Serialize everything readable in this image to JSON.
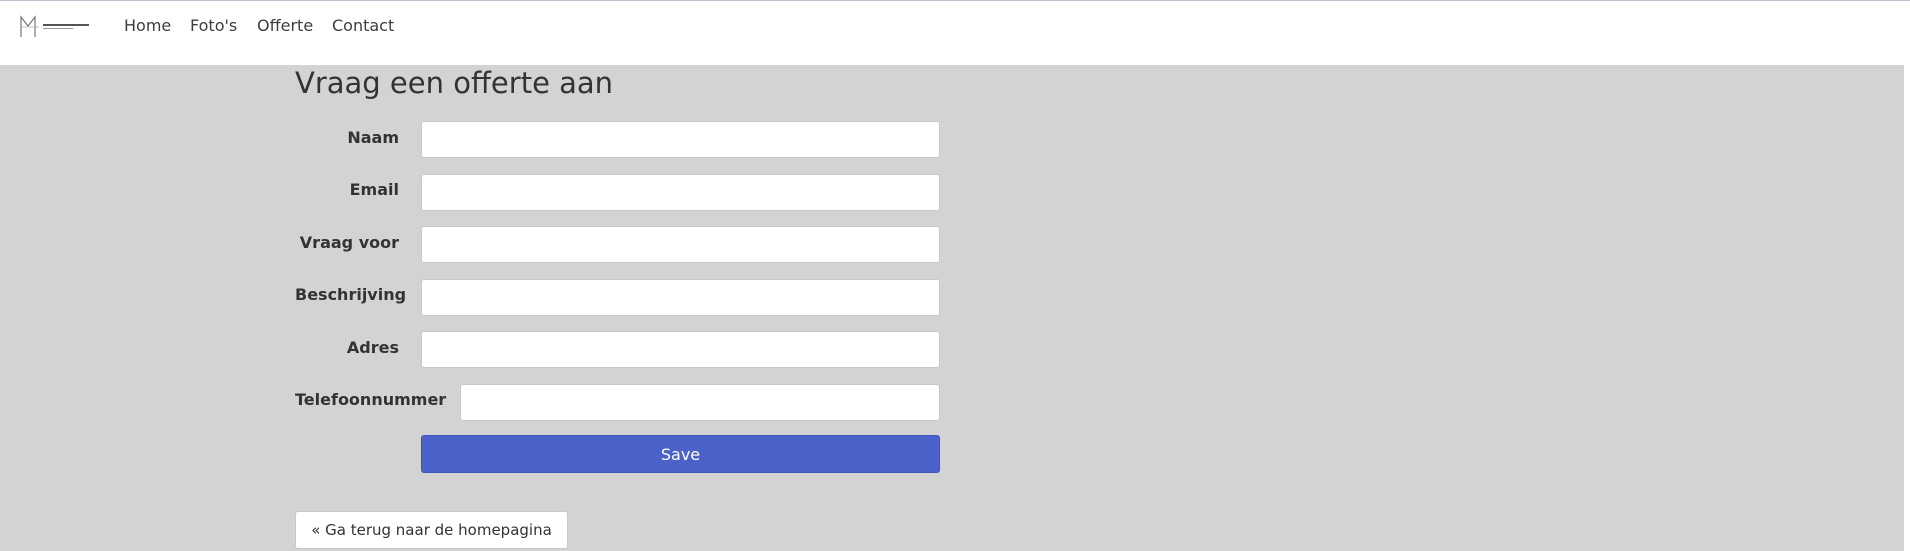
{
  "nav": {
    "items": [
      {
        "label": "Home"
      },
      {
        "label": "Foto's"
      },
      {
        "label": "Offerte"
      },
      {
        "label": "Contact"
      }
    ]
  },
  "form": {
    "title": "Vraag een offerte aan",
    "fields": [
      {
        "label": "Naam",
        "value": ""
      },
      {
        "label": "Email",
        "value": ""
      },
      {
        "label": "Vraag voor",
        "value": ""
      },
      {
        "label": "Beschrijving",
        "value": ""
      },
      {
        "label": "Adres",
        "value": ""
      },
      {
        "label": "Telefoonnummer",
        "value": ""
      }
    ],
    "save_label": "Save"
  },
  "back_link": {
    "label": "« Ga terug naar de homepagina"
  },
  "colors": {
    "page_background": "#d3d3d3",
    "navbar_background": "#ffffff",
    "button_primary": "#4a62c9",
    "text": "#333333"
  }
}
